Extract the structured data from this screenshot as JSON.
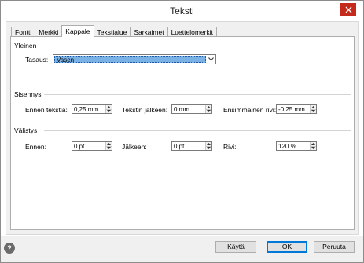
{
  "window": {
    "title": "Teksti"
  },
  "tabs": [
    {
      "label": "Fontti",
      "active": false
    },
    {
      "label": "Merkki",
      "active": false
    },
    {
      "label": "Kappale",
      "active": true
    },
    {
      "label": "Tekstialue",
      "active": false
    },
    {
      "label": "Sarkaimet",
      "active": false
    },
    {
      "label": "Luettelomerkit",
      "active": false
    }
  ],
  "general": {
    "heading": "Yleinen",
    "alignment_label": "Tasaus:",
    "alignment_value": "Vasen"
  },
  "indentation": {
    "heading": "Sisennys",
    "before_text_label": "Ennen tekstiä:",
    "before_text_value": "0,25 mm",
    "after_text_label": "Tekstin jälkeen:",
    "after_text_value": "0 mm",
    "first_line_label": "Ensimmäinen rivi:",
    "first_line_value": "-0,25 mm"
  },
  "spacing": {
    "heading": "Välistys",
    "before_label": "Ennen:",
    "before_value": "0 pt",
    "after_label": "Jälkeen:",
    "after_value": "0 pt",
    "line_label": "Rivi:",
    "line_value": "120 %"
  },
  "footer": {
    "help_glyph": "?",
    "apply_label": "Käytä",
    "ok_label": "OK",
    "cancel_label": "Peruuta"
  },
  "colors": {
    "close_button": "#c42b1c",
    "selection": "#7ab2e6",
    "default_button_border": "#0078d7"
  }
}
